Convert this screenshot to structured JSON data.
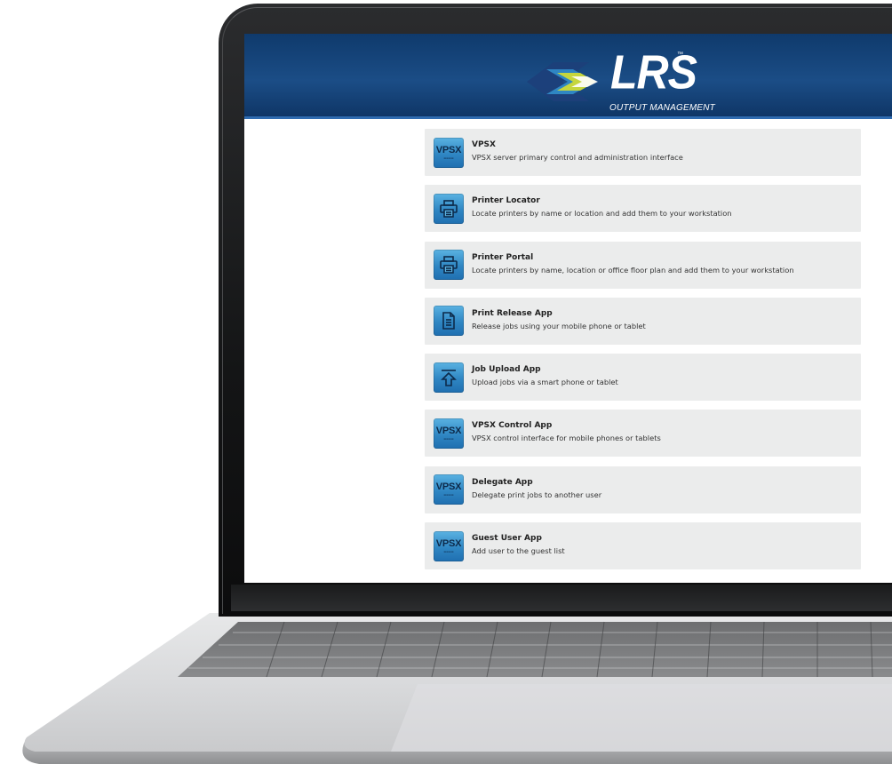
{
  "brand": {
    "logo_text": "LRS",
    "logo_tm": "™",
    "logo_subtitle": "OUTPUT MANAGEMENT",
    "colors": {
      "header": "#1b4d86",
      "chevron_blue": "#2f86c3",
      "chevron_green": "#c5d63d",
      "tile_bg": "#ebecec"
    }
  },
  "apps": [
    {
      "icon": "vpsx-icon",
      "icon_text": "VPSX",
      "title": "VPSX",
      "description": "VPSX server primary control and administration interface"
    },
    {
      "icon": "printer-icon",
      "title": "Printer Locator",
      "description": "Locate printers by name or location and add them to your workstation"
    },
    {
      "icon": "printer-icon",
      "title": "Printer Portal",
      "description": "Locate printers by name, location or office floor plan and add them to your workstation"
    },
    {
      "icon": "document-icon",
      "title": "Print Release App",
      "description": "Release jobs using your mobile phone or tablet"
    },
    {
      "icon": "upload-icon",
      "title": "Job Upload App",
      "description": "Upload jobs via a smart phone or tablet"
    },
    {
      "icon": "vpsx-icon",
      "icon_text": "VPSX",
      "title": "VPSX Control App",
      "description": "VPSX control interface for mobile phones or tablets"
    },
    {
      "icon": "vpsx-icon",
      "icon_text": "VPSX",
      "title": "Delegate App",
      "description": "Delegate print jobs to another user"
    },
    {
      "icon": "vpsx-icon",
      "icon_text": "VPSX",
      "title": "Guest User App",
      "description": "Add user to the guest list"
    }
  ]
}
